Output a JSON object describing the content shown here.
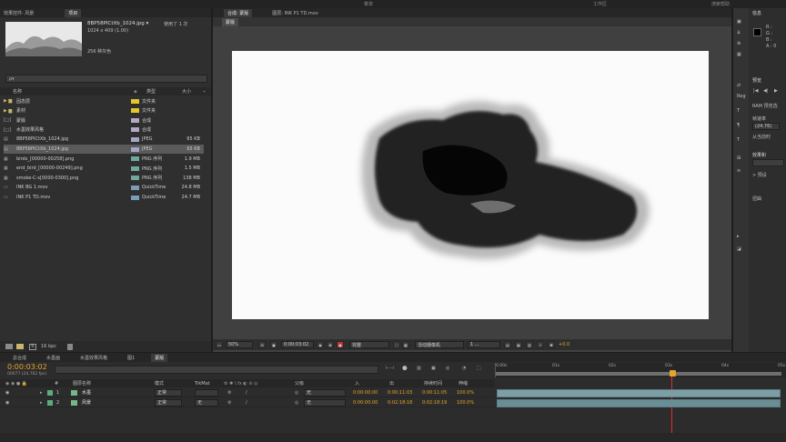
{
  "menu_top": {
    "left_label": "效果控件: 风景",
    "mid_label": "菜单",
    "search_label": "搜索帮助",
    "workspace_label": "工作区"
  },
  "project": {
    "thumb_name": "8BP58PICtXb_1024.jpg ▾",
    "used_count": "使用了 1 次",
    "dimensions": "1024 x 409 (1.00)",
    "color_info": "256 种灰色",
    "search_placeholder": "ρ▾",
    "columns": {
      "name": "名称",
      "type": "类型",
      "size": "大小"
    },
    "items": [
      {
        "name": "固态层",
        "type": "文件夹",
        "size": "",
        "kind": "folder",
        "label_color": "#e3c72a"
      },
      {
        "name": "素材",
        "type": "文件夹",
        "size": "",
        "kind": "folder",
        "label_color": "#e3c72a"
      },
      {
        "name": "蒙版",
        "type": "合成",
        "size": "",
        "kind": "comp",
        "label_color": "#b4a8c4"
      },
      {
        "name": "水墨效果风格",
        "type": "合成",
        "size": "",
        "kind": "comp",
        "label_color": "#b4a8c4"
      },
      {
        "name": "8BP58PICtXb_1024.jpg",
        "type": "JPEG",
        "size": "65 KB",
        "kind": "image",
        "label_color": "#a3a8c9"
      },
      {
        "name": "8BP58PICtXb_1024.jpg",
        "type": "JPEG",
        "size": "65 KB",
        "kind": "image",
        "label_color": "#a3a8c9"
      },
      {
        "name": "birds_[00000-00258].png",
        "type": "PNG 序列",
        "size": "1.9 MB",
        "kind": "seq",
        "label_color": "#6fa99b"
      },
      {
        "name": "end_bird_[00000-00249].png",
        "type": "PNG 序列",
        "size": "1.5 MB",
        "kind": "seq",
        "label_color": "#6fa99b"
      },
      {
        "name": "smoke-C-s[0000-0300].png",
        "type": "PNG 序列",
        "size": "138 MB",
        "kind": "seq",
        "label_color": "#6fa99b"
      },
      {
        "name": "INK BG 1.mov",
        "type": "QuickTime",
        "size": "24.8 MB",
        "kind": "movie",
        "label_color": "#7c9cb6"
      },
      {
        "name": "INK P1 TD.mov",
        "type": "QuickTime",
        "size": "24.7 MB",
        "kind": "movie",
        "label_color": "#7c9cb6"
      }
    ],
    "bpc_label": "16 bpc"
  },
  "viewer": {
    "comp_tab": "合成: 蒙版",
    "footage_tab": "图层: INK P1 TD.mov",
    "sub_tab": "蒙版",
    "zoom": "50%",
    "timecode": "0:00:03:02",
    "quality": "完整",
    "camera": "活动摄像机",
    "views": "1 ...",
    "exposure": "+0.0"
  },
  "info_panel": {
    "title": "信息",
    "r": "R :",
    "g": "G :",
    "b": "B :",
    "a": "A : 0"
  },
  "preview_panel": {
    "title": "预览",
    "ram_label": "RAM 预览选",
    "framerate_label": "帧速率",
    "framerate_value": "(24.76)",
    "from_current": "从当前时",
    "reset_label": "Res"
  },
  "effects_panel": {
    "title": "效果和",
    "group_a": "> 预设",
    "group_b": "扭曲"
  },
  "timeline": {
    "tabs": [
      "总合成",
      "水墨画",
      "水墨效果风格",
      "图1",
      "蒙版"
    ],
    "timecode": "0:00:03:02",
    "fps_info": "00077 (24.762 fps)",
    "columns": {
      "num": "#",
      "layer_name": "图层名称",
      "mode": "模式",
      "trkmat": "TrkMat",
      "parent": "父级",
      "in": "入",
      "out": "出",
      "duration": "持续时间",
      "stretch": "伸缩"
    },
    "layers": [
      {
        "num": "1",
        "name": "水墨",
        "mode": "正常",
        "trkmat": "",
        "parent": "无",
        "in": "0:00:00:00",
        "out": "0:00:11:03",
        "duration": "0:00:11:05",
        "stretch": "100.0%",
        "color": "#5dab7d"
      },
      {
        "name": "风景",
        "num": "2",
        "mode": "正常",
        "trkmat": "无",
        "parent": "无",
        "in": "0:00:00:00",
        "out": "0:02:18:18",
        "duration": "0:02:18:19",
        "stretch": "100.0%",
        "color": "#5dab7d"
      }
    ],
    "ruler_marks": [
      "0:00s",
      "01s",
      "02s",
      "03s",
      "04s",
      "05s"
    ]
  },
  "colors": {
    "timecode_orange": "#e5a52a",
    "playhead_red": "#e02e2e",
    "accent_blue": "#3b7fc4"
  }
}
